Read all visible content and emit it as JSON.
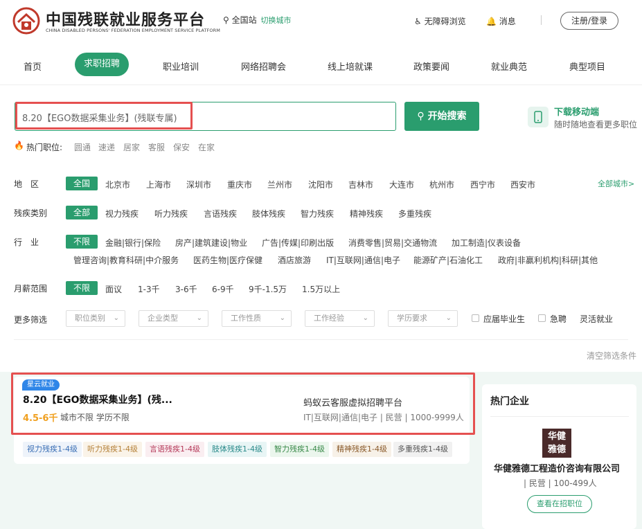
{
  "colors": {
    "brand": "#2a9d6e",
    "highlight": "#e55050",
    "salary": "#f0a020",
    "badge": "#2f86e8"
  },
  "header": {
    "logo_title": "中国残联就业服务平台",
    "logo_subtitle": "CHINA DISABLED PERSONS' FEDERATION EMPLOYMENT SERVICE PLATFORM",
    "location": "全国站",
    "switch_city": "切换城市",
    "accessible": "无障碍浏览",
    "messages": "消息",
    "login": "注册/登录"
  },
  "nav": {
    "home": "首页",
    "jobs": "求职招聘",
    "training": "职业培训",
    "online_fair": "网络招聘会",
    "online_course": "线上培就课",
    "policy": "政策要闻",
    "models": "就业典范",
    "projects": "典型项目"
  },
  "search": {
    "value": "8.20【EGO数据采集业务】(残联专属)",
    "button": "开始搜索",
    "app_title": "下载移动端",
    "app_sub": "随时随地查看更多职位",
    "hot_label": "热门职位:",
    "hot": [
      "圆通",
      "速递",
      "居家",
      "客服",
      "保安",
      "在家"
    ]
  },
  "filters": {
    "region": {
      "label": "地　区",
      "active": "全国",
      "options": [
        "北京市",
        "上海市",
        "深圳市",
        "重庆市",
        "兰州市",
        "沈阳市",
        "吉林市",
        "大连市",
        "杭州市",
        "西宁市",
        "西安市"
      ],
      "all": "全部城市>"
    },
    "disability": {
      "label": "残疾类别",
      "active": "全部",
      "options": [
        "视力残疾",
        "听力残疾",
        "言语残疾",
        "肢体残疾",
        "智力残疾",
        "精神残疾",
        "多重残疾"
      ]
    },
    "industry": {
      "label": "行　业",
      "active": "不限",
      "row1": [
        "金融|银行|保险",
        "房产|建筑建设|物业",
        "广告|传媒|印刷出版",
        "消费零售|贸易|交通物流",
        "加工制造|仪表设备"
      ],
      "row2": [
        "管理咨询|教育科研|中介服务",
        "医药生物|医疗保健",
        "酒店旅游",
        "IT|互联网|通信|电子",
        "能源矿产|石油化工",
        "政府|非赢利机构|科研|其他"
      ]
    },
    "salary": {
      "label": "月薪范围",
      "active": "不限",
      "options": [
        "面议",
        "1-3千",
        "3-6千",
        "6-9千",
        "9千-1.5万",
        "1.5万以上"
      ]
    },
    "more": {
      "label": "更多筛选",
      "dropdowns": [
        "职位类别",
        "企业类型",
        "工作性质",
        "工作经验",
        "学历要求"
      ],
      "checks": [
        "应届毕业生",
        "急聘"
      ],
      "flex": "灵活就业"
    },
    "clear": "清空筛选条件"
  },
  "job": {
    "badge": "星云就业",
    "title": "8.20【EGO数据采集业务】(残...",
    "salary": "4.5-6千",
    "meta": "城市不限  学历不限",
    "company": "蚂蚁云客服虚拟招聘平台",
    "company_info": "IT|互联网|通信|电子 | 民营 | 1000-9999人",
    "tags": [
      {
        "label": "视力残疾1-4级",
        "color": "#3a6fb5",
        "bg": "#eef3fa"
      },
      {
        "label": "听力残疾1-4级",
        "color": "#b5823a",
        "bg": "#faf3e8"
      },
      {
        "label": "言语残疾1-4级",
        "color": "#b53a5a",
        "bg": "#faeef1"
      },
      {
        "label": "肢体残疾1-4级",
        "color": "#2a8a8a",
        "bg": "#e8f5f5"
      },
      {
        "label": "智力残疾1-4级",
        "color": "#3a8a4a",
        "bg": "#ebf6ed"
      },
      {
        "label": "精神残疾1-4级",
        "color": "#8a5a2a",
        "bg": "#f7f1e8"
      },
      {
        "label": "多重残疾1-4级",
        "color": "#555555",
        "bg": "#f1f1f1"
      }
    ]
  },
  "sidebar": {
    "title": "热门企业",
    "logo_text": "华健雅德",
    "logo_line1": "华健",
    "logo_line2": "雅德",
    "company": "华健雅德工程造价咨询有限公司",
    "info": "| 民营 | 100-499人",
    "button": "查看在招职位"
  }
}
